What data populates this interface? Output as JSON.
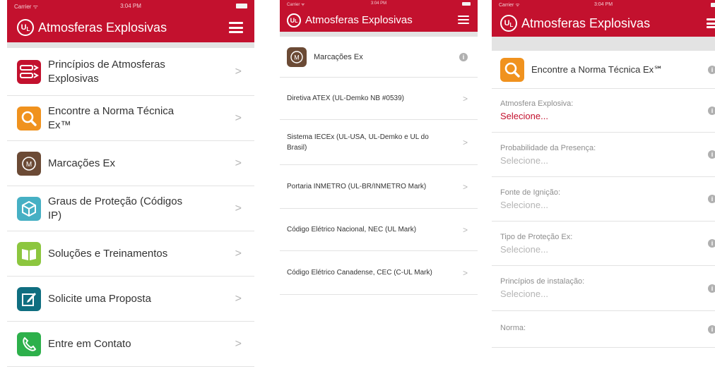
{
  "status": {
    "carrier": "Carrier ᯤ",
    "time_1": "3:04 PM",
    "time_2": "3:04 PM",
    "time_3": "3:04 PM"
  },
  "app": {
    "title": "Atmosferas Explosivas",
    "logo_text": "UL"
  },
  "colors": {
    "brand": "#c3112e",
    "tile_red": "#c3112e",
    "tile_orange": "#f0921e",
    "tile_brown": "#6b4a35",
    "tile_teal": "#46b0c4",
    "tile_lime": "#8cc63f",
    "tile_darkteal": "#0f6e80",
    "tile_green": "#2db04b"
  },
  "screen1": {
    "items": [
      {
        "label": "Princípios de Atmosferas Explosivas",
        "icon": "arrows-icon"
      },
      {
        "label": "Encontre a Norma Técnica Ex™",
        "icon": "magnifier-icon"
      },
      {
        "label": "Marcações Ex",
        "icon": "m-badge-icon"
      },
      {
        "label": "Graus de Proteção (Códigos IP)",
        "icon": "cube-icon"
      },
      {
        "label": "Soluções e Treinamentos",
        "icon": "book-icon"
      },
      {
        "label": "Solicite uma Proposta",
        "icon": "edit-icon"
      },
      {
        "label": "Entre em Contato",
        "icon": "phone-icon"
      }
    ]
  },
  "screen2": {
    "header": "Marcações Ex",
    "items": [
      "Diretiva ATEX (UL-Demko NB #0539)",
      "Sistema IECEx (UL-USA, UL-Demko e UL do Brasil)",
      "Portaria INMETRO (UL-BR/INMETRO Mark)",
      "Código Elétrico Nacional, NEC (UL Mark)",
      "Código Elétrico Canadense, CEC (C-UL Mark)"
    ]
  },
  "screen3": {
    "header": "Encontre a Norma Técnica Ex℠",
    "fields": [
      {
        "label": "Atmosfera Explosiva:",
        "value": "Selecione...",
        "active": true
      },
      {
        "label": "Probabilidade da Presença:",
        "value": "Selecione...",
        "active": false
      },
      {
        "label": "Fonte de Ignição:",
        "value": "Selecione...",
        "active": false
      },
      {
        "label": "Tipo de Proteção Ex:",
        "value": "Selecione...",
        "active": false
      },
      {
        "label": "Princípios de instalação:",
        "value": "Selecione...",
        "active": false
      },
      {
        "label": "Norma:",
        "value": "",
        "active": false
      }
    ]
  }
}
